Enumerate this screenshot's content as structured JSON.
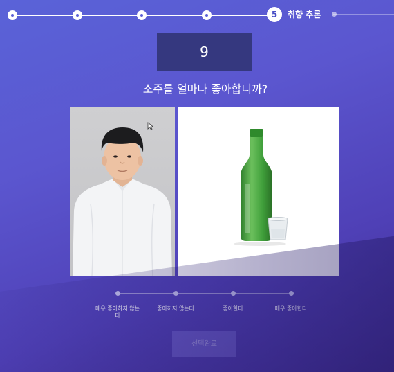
{
  "progress": {
    "current_step_number": "5",
    "current_step_label": "취향 추론"
  },
  "counter": {
    "value": "9"
  },
  "question": {
    "text": "소주를 얼마나 좋아합니까?"
  },
  "scale": {
    "options": [
      {
        "label": "매우 좋아하지 않는다"
      },
      {
        "label": "좋아하지 않는다"
      },
      {
        "label": "좋아한다"
      },
      {
        "label": "매우 좋아한다"
      }
    ]
  },
  "submit": {
    "label": "선택완료"
  },
  "colors": {
    "background": "#5a5fd6",
    "counter_box": "#35387f",
    "bottle_green": "#3f9f3a"
  }
}
